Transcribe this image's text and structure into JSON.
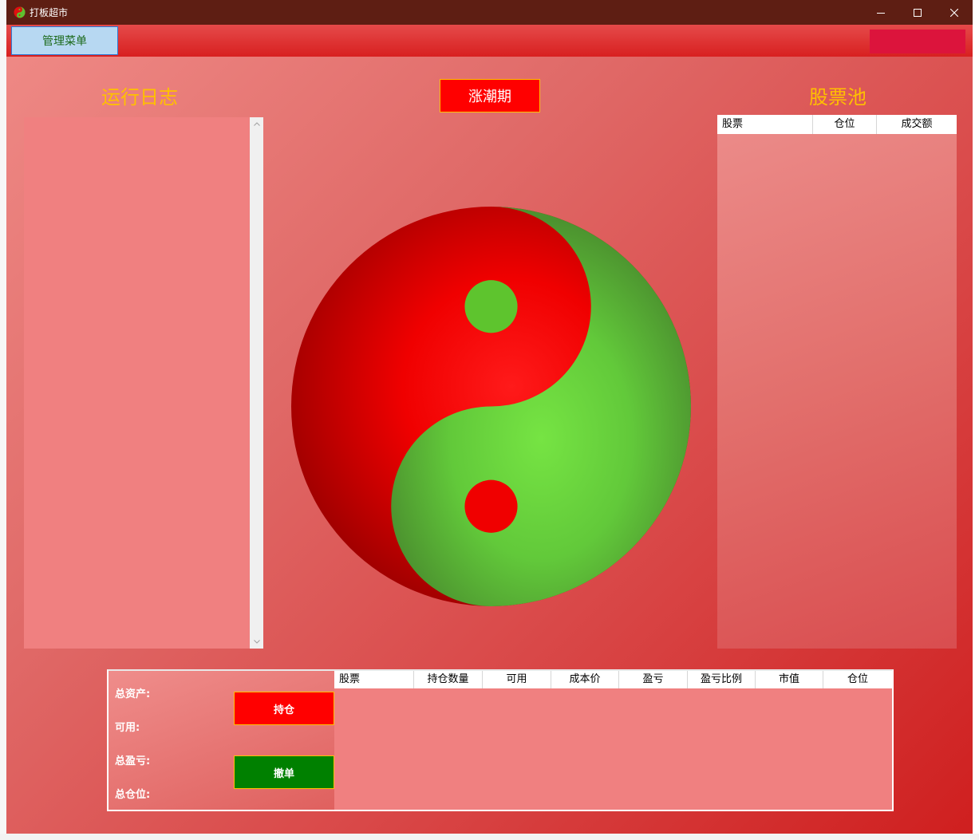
{
  "window": {
    "title": "打板超市"
  },
  "menubar": {
    "manage_menu_label": "管理菜单"
  },
  "log": {
    "title": "运行日志"
  },
  "phase": {
    "label": "涨潮期"
  },
  "pool": {
    "title": "股票池",
    "columns": [
      "股票",
      "仓位",
      "成交额"
    ]
  },
  "account": {
    "total_assets_label": "总资产:",
    "available_label": "可用:",
    "total_pnl_label": "总盈亏:",
    "total_position_label": "总仓位:"
  },
  "actions": {
    "hold_label": "持仓",
    "cancel_label": "撤单"
  },
  "positions": {
    "columns": [
      "股票",
      "持仓数量",
      "可用",
      "成本价",
      "盈亏",
      "盈亏比例",
      "市值",
      "仓位"
    ]
  },
  "colors": {
    "titlebar": "#5e1e13",
    "accent_gold": "#ffc000",
    "red": "#ff0000",
    "green": "#008000",
    "panel_pink": "#f08080"
  },
  "icons": {
    "app": "yin-yang-icon",
    "minimize": "minimize-icon",
    "maximize": "maximize-icon",
    "close": "close-icon"
  }
}
